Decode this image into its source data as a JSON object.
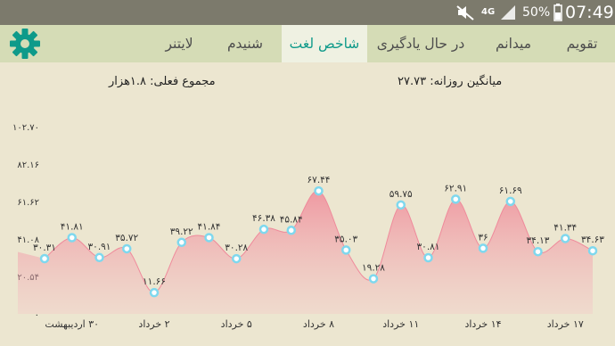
{
  "status_bar": {
    "time": "07:49",
    "battery": "50%",
    "network": "4G",
    "icons": [
      "mute-icon",
      "signal-icon",
      "battery-icon"
    ]
  },
  "tabs": [
    {
      "label": "تقویم",
      "active": false
    },
    {
      "label": "میدانم",
      "active": false
    },
    {
      "label": "در حال یادگیری",
      "active": false
    },
    {
      "label": "شاخص لغت",
      "active": true
    },
    {
      "label": "شنیدم",
      "active": false
    },
    {
      "label": "لایتنر",
      "active": false
    }
  ],
  "settings_icon": "gear-icon",
  "summary": {
    "total": "مجموع فعلی: ۱.۸هزار",
    "daily_average": "میانگین روزانه: ۲۷.۷۳"
  },
  "colors": {
    "accent": "#0e9a8a",
    "app_bar": "#d5dcb6",
    "background": "#ece6d0",
    "area_fill": "#f1a5b2",
    "point": "#7fd8ee"
  },
  "chart_data": {
    "type": "area",
    "y_ticks": [
      "۰",
      "۲۰.۵۴",
      "۴۱.۰۸",
      "۶۱.۶۲",
      "۸۲.۱۶",
      "۱۰۲.۷۰"
    ],
    "ylim": [
      0,
      102.7
    ],
    "grid": false,
    "x_labels": [
      "۳۰ اردیبهشت",
      "۲ خرداد",
      "۵ خرداد",
      "۸ خرداد",
      "۱۱ خرداد",
      "۱۴ خرداد",
      "۱۷ خرداد"
    ],
    "values": [
      30.31,
      41.81,
      30.91,
      35.72,
      11.66,
      39.22,
      41.84,
      30.28,
      46.38,
      45.84,
      67.44,
      35.03,
      19.28,
      59.75,
      30.81,
      62.91,
      36,
      61.69,
      34.13,
      41.34,
      34.63
    ],
    "value_labels": [
      "۳۰.۳۱",
      "۴۱.۸۱",
      "۳۰.۹۱",
      "۳۵.۷۲",
      "۱۱.۶۶",
      "۳۹.۲۲",
      "۴۱.۸۴",
      "۳۰.۲۸",
      "۴۶.۳۸",
      "۴۵.۸۴",
      "۶۷.۴۴",
      "۳۵.۰۳",
      "۱۹.۲۸",
      "۵۹.۷۵",
      "۳۰.۸۱",
      "۶۲.۹۱",
      "۳۶",
      "۶۱.۶۹",
      "۳۴.۱۳",
      "۴۱.۳۴",
      "۳۴.۶۳"
    ]
  }
}
